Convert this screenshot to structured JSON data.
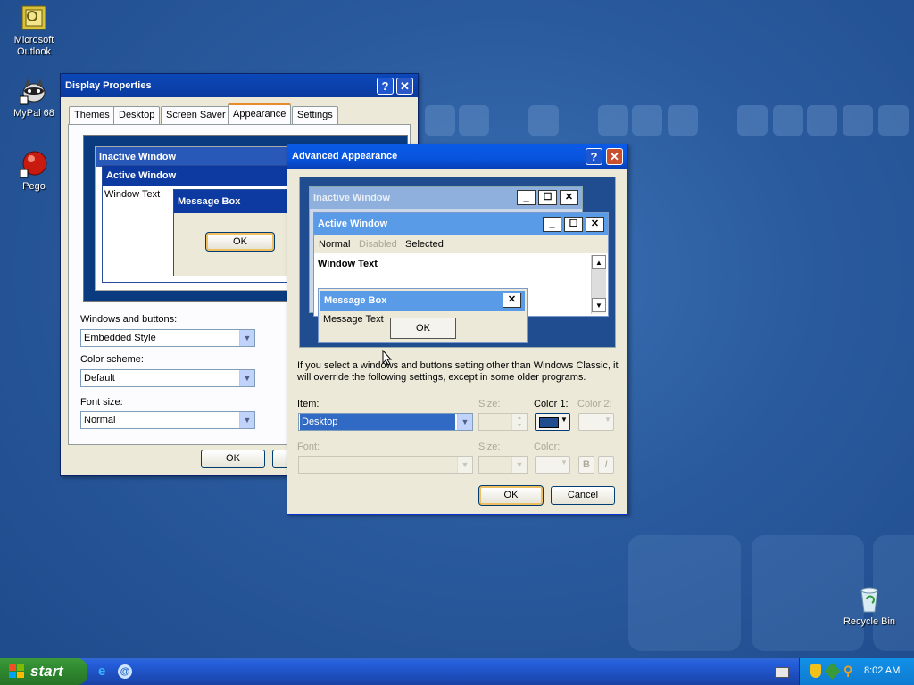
{
  "desktop": {
    "icons": [
      {
        "label": "Microsoft Outlook",
        "icon": "outlook-icon"
      },
      {
        "label": "MyPal 68",
        "icon": "raccoon-icon"
      },
      {
        "label": "Pego",
        "icon": "red-ball-icon"
      },
      {
        "label": "Recycle Bin",
        "icon": "recycle-bin-icon"
      }
    ]
  },
  "display_properties": {
    "title": "Display Properties",
    "tabs": [
      "Themes",
      "Desktop",
      "Screen Saver",
      "Appearance",
      "Settings"
    ],
    "selected_tab": "Appearance",
    "preview": {
      "inactive_title": "Inactive Window",
      "active_title": "Active Window",
      "window_text": "Window Text",
      "message_box_title": "Message Box",
      "ok": "OK"
    },
    "windows_buttons_label": "Windows and buttons:",
    "windows_buttons_value": "Embedded Style",
    "color_scheme_label": "Color scheme:",
    "color_scheme_value": "Default",
    "font_size_label": "Font size:",
    "font_size_value": "Normal",
    "ok_label": "OK"
  },
  "advanced_appearance": {
    "title": "Advanced Appearance",
    "preview": {
      "inactive_title": "Inactive Window",
      "active_title": "Active Window",
      "menu_normal": "Normal",
      "menu_disabled": "Disabled",
      "menu_selected": "Selected",
      "window_text": "Window Text",
      "message_box_title": "Message Box",
      "message_text": "Message Text",
      "ok": "OK"
    },
    "note": "If you select a windows and buttons setting other than Windows Classic, it will override the following settings, except in some older programs.",
    "item_label": "Item:",
    "item_value": "Desktop",
    "size_label": "Size:",
    "color1_label": "Color 1:",
    "color2_label": "Color 2:",
    "font_label": "Font:",
    "font_size_label": "Size:",
    "font_color_label": "Color:",
    "bold_label": "B",
    "italic_label": "I",
    "ok_label": "OK",
    "cancel_label": "Cancel",
    "color1_swatch": "#1f4d8f"
  },
  "taskbar": {
    "start_label": "start",
    "clock": "8:02 AM"
  }
}
